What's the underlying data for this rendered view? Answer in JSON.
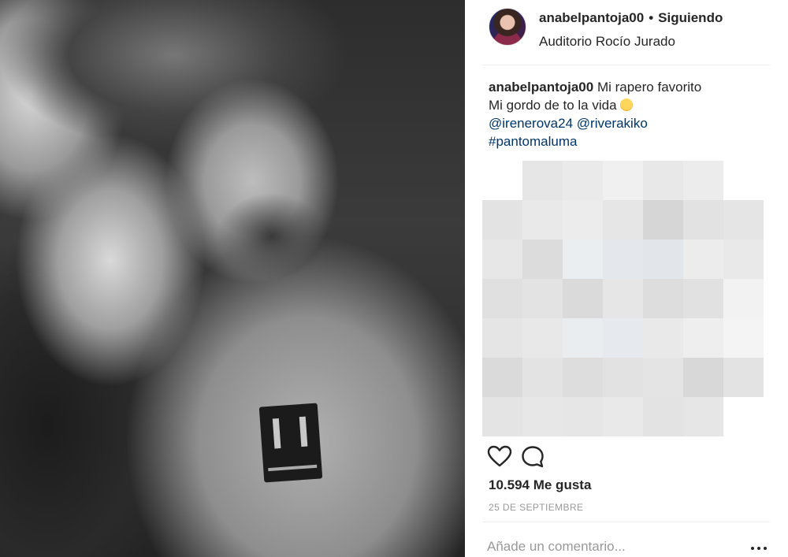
{
  "post": {
    "photo_icon": "photo-image",
    "header": {
      "username": "anabelpantoja00",
      "separator": "•",
      "follow_status": "Siguiendo",
      "location": "Auditorio Rocío Jurado"
    },
    "caption": {
      "username": "anabelpantoja00",
      "line1": "Mi rapero favorito",
      "line2": "Mi gordo de to la vida",
      "mentions": [
        "@irenerova24",
        "@riverakiko"
      ],
      "hashtag": "#pantomaluma"
    },
    "actions": {
      "like_icon": "heart-outline-icon",
      "comment_icon": "comment-bubble-icon"
    },
    "likes": "10.594 Me gusta",
    "date": "25 DE SEPTIEMBRE",
    "comment_placeholder": "Añade un comentario...",
    "more_icon": "ellipsis-icon"
  },
  "colors": {
    "text": "#262626",
    "link": "#003569",
    "muted": "#999999",
    "divider": "#efefef"
  }
}
